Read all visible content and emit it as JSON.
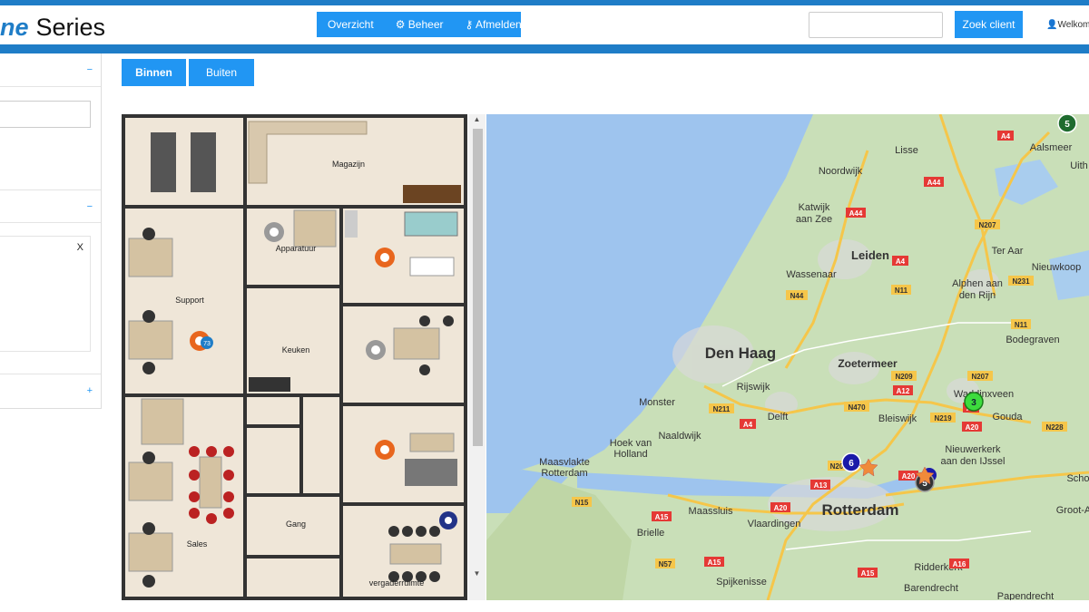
{
  "brand": {
    "accent": "ne",
    "name": "Series"
  },
  "nav": {
    "overview": "Overzicht",
    "manage": "Beheer",
    "logout": "Afmelden"
  },
  "search": {
    "button": "Zoek client",
    "value": ""
  },
  "user": {
    "welcome": "Welkom: "
  },
  "sidebar": {
    "toggle1": "−",
    "toggle2": "−",
    "toggle3": "+",
    "close": "X"
  },
  "tabs": {
    "inside": "Binnen",
    "outside": "Buiten"
  },
  "floorplan": {
    "rooms": {
      "storage": "Magazijn",
      "equipment": "Apparatuur",
      "support": "Support",
      "kitchen": "Keuken",
      "sales": "Sales",
      "hall": "Gang",
      "meeting": "vergaderruimte"
    },
    "badge": "73"
  },
  "map": {
    "cities": {
      "lisse": "Lisse",
      "aalsmeer": "Aalsmeer",
      "uith": "Uith",
      "noordwijk": "Noordwijk",
      "katwijk1": "Katwijk",
      "katwijk2": "aan Zee",
      "leiden": "Leiden",
      "teraar": "Ter Aar",
      "nieuwkoop": "Nieuwkoop",
      "wassenaar": "Wassenaar",
      "alphen1": "Alphen aan",
      "alphen2": "den Rijn",
      "bodegraven": "Bodegraven",
      "denhaag": "Den Haag",
      "zoetermeer": "Zoetermeer",
      "rijswijk": "Rijswijk",
      "monster": "Monster",
      "delft": "Delft",
      "bleiswijk": "Bleiswijk",
      "waddinxveen": "Waddinxveen",
      "gouda": "Gouda",
      "naaldwijk": "Naaldwijk",
      "hoek1": "Hoek van",
      "hoek2": "Holland",
      "nieuwerkerk1": "Nieuwerkerk",
      "nieuwerkerk2": "aan den IJssel",
      "maasvlakte1": "Maasvlakte",
      "maasvlakte2": "Rotterdam",
      "maassluis": "Maassluis",
      "rotterdam": "Rotterdam",
      "vlaardingen": "Vlaardingen",
      "grootam": "Groot-A",
      "scho": "Scho",
      "brielle": "Brielle",
      "spijkenisse": "Spijkenisse",
      "ridderkerk": "Ridderkerk",
      "barendrecht": "Barendrecht",
      "papendrecht": "Papendrecht"
    },
    "roads": {
      "a4a": "A4",
      "a44a": "A44",
      "a44b": "A44",
      "a4b": "A4",
      "n207a": "N207",
      "n44": "N44",
      "n11a": "N11",
      "n231": "N231",
      "n11b": "N11",
      "n209a": "N209",
      "n207b": "N207",
      "a12": "A12",
      "n470": "N470",
      "n211": "N211",
      "a4c": "A4",
      "n219": "N219",
      "a20a": "A20",
      "n228": "N228",
      "a13": "A13",
      "n15": "N15",
      "a20b": "A20",
      "a15a": "A15",
      "a15b": "A15",
      "n57": "N57",
      "a15c": "A15",
      "a16": "A16",
      "a1x": "A1",
      "a20c": "A20",
      "n20": "N20"
    },
    "markers": {
      "m5top": "5",
      "m3": "3",
      "m6": "6",
      "m5": "5"
    }
  }
}
